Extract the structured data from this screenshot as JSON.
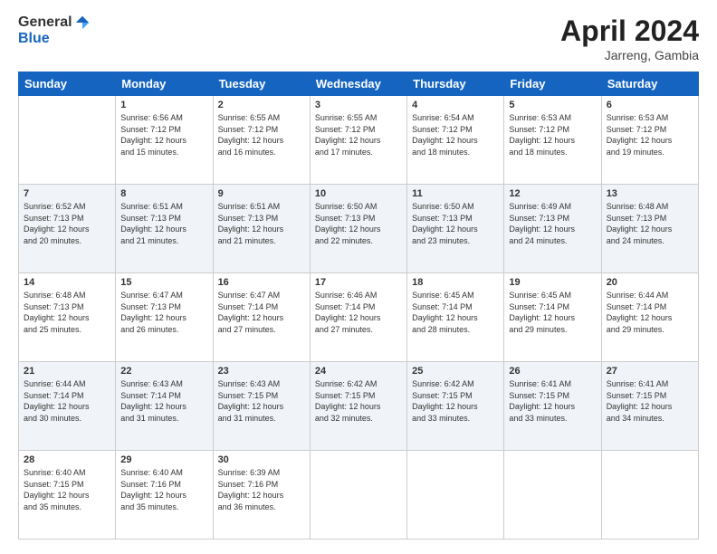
{
  "logo": {
    "general": "General",
    "blue": "Blue"
  },
  "title": "April 2024",
  "location": "Jarreng, Gambia",
  "days_of_week": [
    "Sunday",
    "Monday",
    "Tuesday",
    "Wednesday",
    "Thursday",
    "Friday",
    "Saturday"
  ],
  "weeks": [
    [
      {
        "day": "",
        "sunrise": "",
        "sunset": "",
        "daylight": ""
      },
      {
        "day": "1",
        "sunrise": "6:56 AM",
        "sunset": "7:12 PM",
        "daylight": "12 hours and 15 minutes."
      },
      {
        "day": "2",
        "sunrise": "6:55 AM",
        "sunset": "7:12 PM",
        "daylight": "12 hours and 16 minutes."
      },
      {
        "day": "3",
        "sunrise": "6:55 AM",
        "sunset": "7:12 PM",
        "daylight": "12 hours and 17 minutes."
      },
      {
        "day": "4",
        "sunrise": "6:54 AM",
        "sunset": "7:12 PM",
        "daylight": "12 hours and 18 minutes."
      },
      {
        "day": "5",
        "sunrise": "6:53 AM",
        "sunset": "7:12 PM",
        "daylight": "12 hours and 18 minutes."
      },
      {
        "day": "6",
        "sunrise": "6:53 AM",
        "sunset": "7:12 PM",
        "daylight": "12 hours and 19 minutes."
      }
    ],
    [
      {
        "day": "7",
        "sunrise": "6:52 AM",
        "sunset": "7:13 PM",
        "daylight": "12 hours and 20 minutes."
      },
      {
        "day": "8",
        "sunrise": "6:51 AM",
        "sunset": "7:13 PM",
        "daylight": "12 hours and 21 minutes."
      },
      {
        "day": "9",
        "sunrise": "6:51 AM",
        "sunset": "7:13 PM",
        "daylight": "12 hours and 21 minutes."
      },
      {
        "day": "10",
        "sunrise": "6:50 AM",
        "sunset": "7:13 PM",
        "daylight": "12 hours and 22 minutes."
      },
      {
        "day": "11",
        "sunrise": "6:50 AM",
        "sunset": "7:13 PM",
        "daylight": "12 hours and 23 minutes."
      },
      {
        "day": "12",
        "sunrise": "6:49 AM",
        "sunset": "7:13 PM",
        "daylight": "12 hours and 24 minutes."
      },
      {
        "day": "13",
        "sunrise": "6:48 AM",
        "sunset": "7:13 PM",
        "daylight": "12 hours and 24 minutes."
      }
    ],
    [
      {
        "day": "14",
        "sunrise": "6:48 AM",
        "sunset": "7:13 PM",
        "daylight": "12 hours and 25 minutes."
      },
      {
        "day": "15",
        "sunrise": "6:47 AM",
        "sunset": "7:13 PM",
        "daylight": "12 hours and 26 minutes."
      },
      {
        "day": "16",
        "sunrise": "6:47 AM",
        "sunset": "7:14 PM",
        "daylight": "12 hours and 27 minutes."
      },
      {
        "day": "17",
        "sunrise": "6:46 AM",
        "sunset": "7:14 PM",
        "daylight": "12 hours and 27 minutes."
      },
      {
        "day": "18",
        "sunrise": "6:45 AM",
        "sunset": "7:14 PM",
        "daylight": "12 hours and 28 minutes."
      },
      {
        "day": "19",
        "sunrise": "6:45 AM",
        "sunset": "7:14 PM",
        "daylight": "12 hours and 29 minutes."
      },
      {
        "day": "20",
        "sunrise": "6:44 AM",
        "sunset": "7:14 PM",
        "daylight": "12 hours and 29 minutes."
      }
    ],
    [
      {
        "day": "21",
        "sunrise": "6:44 AM",
        "sunset": "7:14 PM",
        "daylight": "12 hours and 30 minutes."
      },
      {
        "day": "22",
        "sunrise": "6:43 AM",
        "sunset": "7:14 PM",
        "daylight": "12 hours and 31 minutes."
      },
      {
        "day": "23",
        "sunrise": "6:43 AM",
        "sunset": "7:15 PM",
        "daylight": "12 hours and 31 minutes."
      },
      {
        "day": "24",
        "sunrise": "6:42 AM",
        "sunset": "7:15 PM",
        "daylight": "12 hours and 32 minutes."
      },
      {
        "day": "25",
        "sunrise": "6:42 AM",
        "sunset": "7:15 PM",
        "daylight": "12 hours and 33 minutes."
      },
      {
        "day": "26",
        "sunrise": "6:41 AM",
        "sunset": "7:15 PM",
        "daylight": "12 hours and 33 minutes."
      },
      {
        "day": "27",
        "sunrise": "6:41 AM",
        "sunset": "7:15 PM",
        "daylight": "12 hours and 34 minutes."
      }
    ],
    [
      {
        "day": "28",
        "sunrise": "6:40 AM",
        "sunset": "7:15 PM",
        "daylight": "12 hours and 35 minutes."
      },
      {
        "day": "29",
        "sunrise": "6:40 AM",
        "sunset": "7:16 PM",
        "daylight": "12 hours and 35 minutes."
      },
      {
        "day": "30",
        "sunrise": "6:39 AM",
        "sunset": "7:16 PM",
        "daylight": "12 hours and 36 minutes."
      },
      {
        "day": "",
        "sunrise": "",
        "sunset": "",
        "daylight": ""
      },
      {
        "day": "",
        "sunrise": "",
        "sunset": "",
        "daylight": ""
      },
      {
        "day": "",
        "sunrise": "",
        "sunset": "",
        "daylight": ""
      },
      {
        "day": "",
        "sunrise": "",
        "sunset": "",
        "daylight": ""
      }
    ]
  ],
  "labels": {
    "sunrise_prefix": "Sunrise: ",
    "sunset_prefix": "Sunset: ",
    "daylight_prefix": "Daylight: "
  }
}
